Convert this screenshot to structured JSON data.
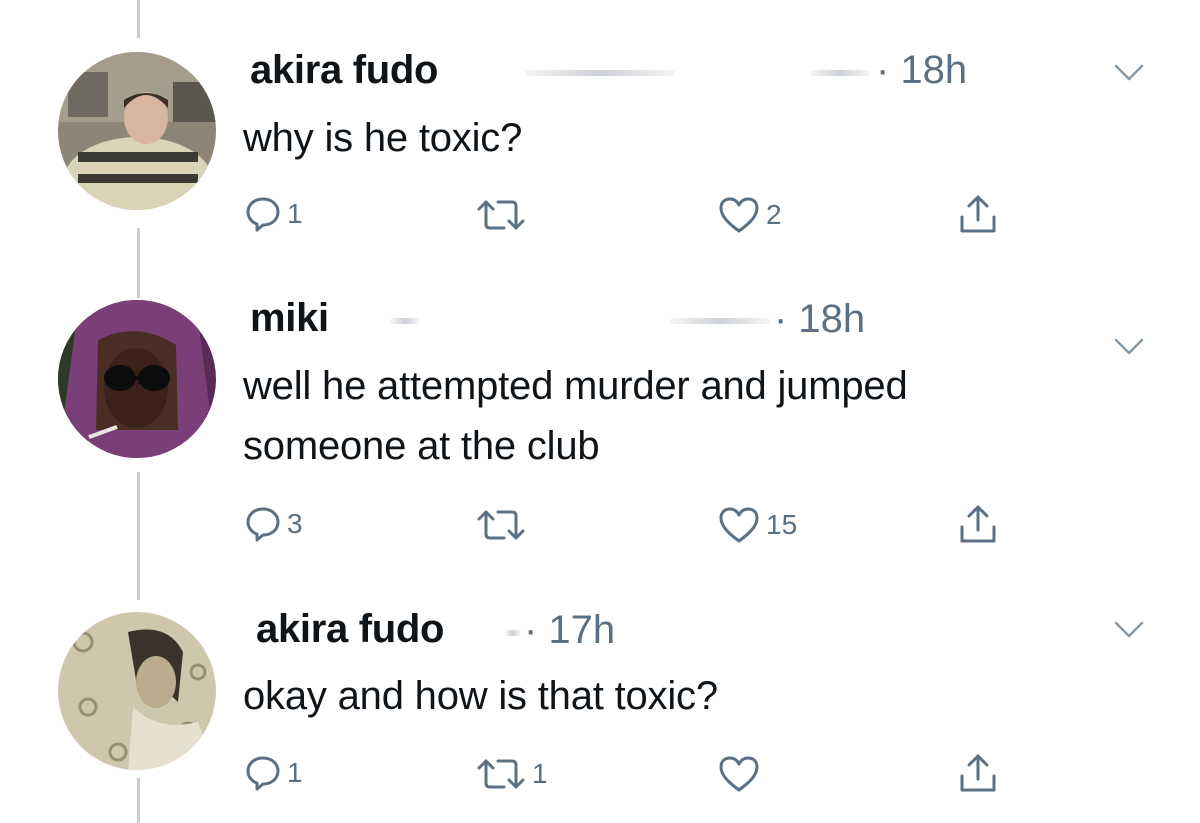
{
  "tweets": [
    {
      "name": "akira fudo",
      "time": "· 18h",
      "text_lines": [
        "why is   he toxic?"
      ],
      "replies": "1",
      "retweets": "",
      "likes": "2"
    },
    {
      "name": "miki",
      "time": "· 18h",
      "text_lines": [
        "well  he attempted murder and jumped",
        "someone at the club"
      ],
      "replies": "3",
      "retweets": "",
      "likes": "15"
    },
    {
      "name": "akira fudo",
      "time": "· 17h",
      "text_lines": [
        "okay and how is that toxic?"
      ],
      "replies": "1",
      "retweets": "1",
      "likes": ""
    }
  ],
  "icons": {
    "reply": "reply-icon",
    "retweet": "retweet-icon",
    "like": "heart-icon",
    "share": "share-icon",
    "menu": "chevron-down-icon"
  },
  "colors": {
    "text": "#0f1419",
    "secondary": "#5b7083",
    "thread_line": "#c7cdd3"
  }
}
